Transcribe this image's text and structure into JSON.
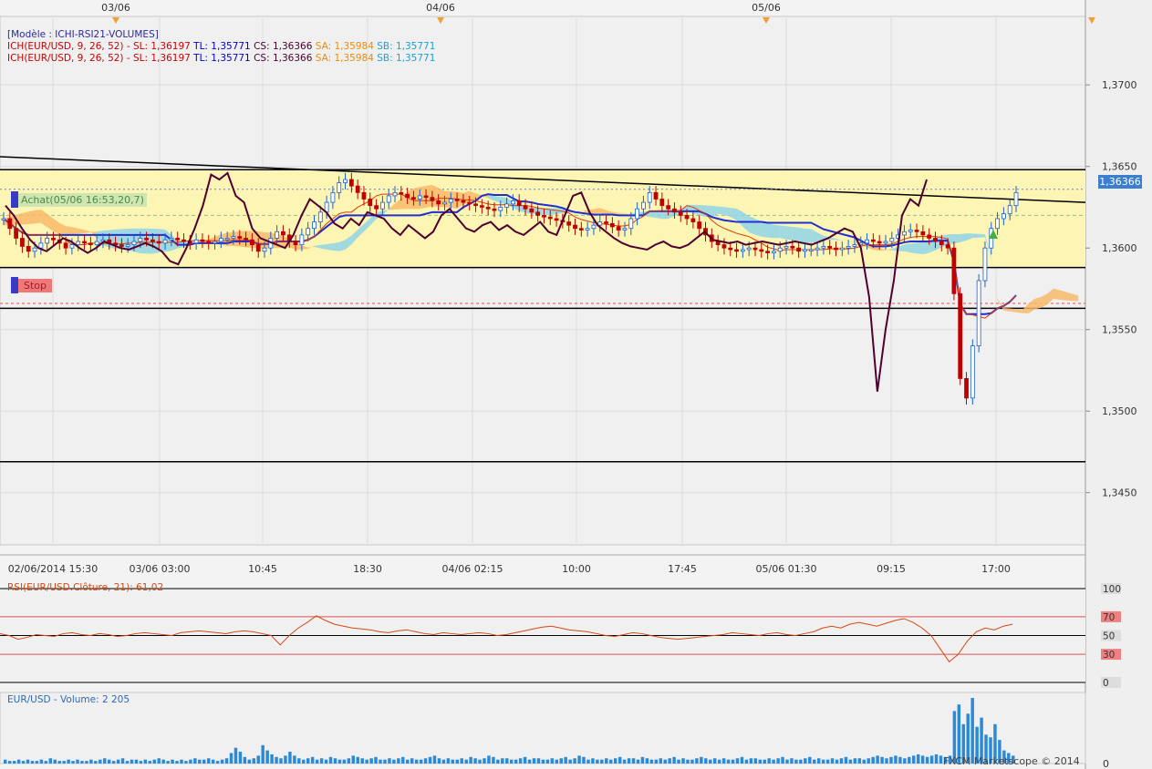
{
  "header": {
    "model": "[Modèle : ICHI-RSI21-VOLUMES]",
    "ich_lines": [
      {
        "prefix": "ICH(EUR/USD, 9, 26, 52) -",
        "sl": "SL: 1,36197",
        "tl": "TL: 1,35771",
        "cs": "CS: 1,36366",
        "sa": "SA: 1,35984",
        "sb": "SB: 1,35771"
      },
      {
        "prefix": "ICH(EUR/USD, 9, 26, 52) -",
        "sl": "SL: 1,36197",
        "tl": "TL: 1,35771",
        "cs": "CS: 1,36366",
        "sa": "SA: 1,35984",
        "sb": "SB: 1,35771"
      }
    ]
  },
  "colors": {
    "prefix": "#cc0000",
    "sl": "#cc0000",
    "tl": "#0000cc",
    "cs": "#4a0030",
    "sa": "#f08a00",
    "sb": "#1fa0d0",
    "price_up": "#1a5fd0",
    "price_down": "#c00000",
    "lagging": "#500030",
    "kijun": "#1f2fd0",
    "tenkan": "#e03a00",
    "cloud_bull": "#f8b86a",
    "cloud_bear": "#8fd4e8",
    "band": "#fcf5b4",
    "rsi": "#d24a14",
    "volume": "#2a8ad8"
  },
  "top_dates": [
    "03/06",
    "04/06",
    "05/06"
  ],
  "annotations": {
    "achat": "Achat(05/06 16:53,20,7)",
    "stop": "Stop",
    "current_price": "1,36366"
  },
  "chart_data": [
    {
      "type": "line",
      "title": "EUR/USD",
      "x_tick_labels": [
        "02/06/2014 15:30",
        "03/06 03:00",
        "10:45",
        "18:30",
        "04/06 02:15",
        "10:00",
        "17:45",
        "05/06 01:30",
        "09:15",
        "17:00"
      ],
      "y_tick_labels": [
        "1,3700",
        "1,3650",
        "1,3600",
        "1,3550",
        "1,3500",
        "1,3450"
      ],
      "ylim": [
        1.3418,
        1.3742
      ],
      "price_series": [
        1.3618,
        1.3612,
        1.3606,
        1.3601,
        1.3598,
        1.36,
        1.3603,
        1.3606,
        1.3605,
        1.3603,
        1.36,
        1.3602,
        1.3604,
        1.3603,
        1.3602,
        1.3604,
        1.3605,
        1.3603,
        1.3602,
        1.3601,
        1.3602,
        1.3604,
        1.3606,
        1.3605,
        1.3604,
        1.3603,
        1.3605,
        1.3606,
        1.3605,
        1.3604,
        1.3603,
        1.3605,
        1.3604,
        1.3603,
        1.3604,
        1.3606,
        1.3606,
        1.3607,
        1.3606,
        1.3605,
        1.3602,
        1.3598,
        1.36,
        1.3606,
        1.361,
        1.3608,
        1.3604,
        1.3602,
        1.3608,
        1.3612,
        1.3616,
        1.3622,
        1.3628,
        1.3634,
        1.364,
        1.3642,
        1.3638,
        1.3634,
        1.363,
        1.3626,
        1.3624,
        1.3628,
        1.3632,
        1.3634,
        1.3633,
        1.3631,
        1.363,
        1.3632,
        1.3631,
        1.3629,
        1.3627,
        1.3628,
        1.363,
        1.3629,
        1.3628,
        1.3627,
        1.3626,
        1.3625,
        1.3624,
        1.3623,
        1.3625,
        1.3627,
        1.3629,
        1.3626,
        1.3624,
        1.3622,
        1.362,
        1.3619,
        1.3618,
        1.3617,
        1.3616,
        1.3614,
        1.3612,
        1.3611,
        1.3612,
        1.3614,
        1.3616,
        1.3615,
        1.3613,
        1.3611,
        1.3612,
        1.3618,
        1.3624,
        1.3628,
        1.3634,
        1.363,
        1.3626,
        1.3624,
        1.3622,
        1.362,
        1.3618,
        1.3616,
        1.3612,
        1.3608,
        1.3604,
        1.3602,
        1.36,
        1.3599,
        1.3598,
        1.3599,
        1.36,
        1.3599,
        1.3598,
        1.3597,
        1.3598,
        1.36,
        1.3601,
        1.36,
        1.3598,
        1.3599,
        1.3599,
        1.36,
        1.3601,
        1.36,
        1.3599,
        1.36,
        1.3601,
        1.3602,
        1.3603,
        1.3605,
        1.3604,
        1.3603,
        1.3604,
        1.3606,
        1.3608,
        1.361,
        1.3611,
        1.361,
        1.3608,
        1.3606,
        1.3604,
        1.3602,
        1.36,
        1.3572,
        1.352,
        1.3508,
        1.354,
        1.358,
        1.36,
        1.3612,
        1.3618,
        1.3621,
        1.3626,
        1.3634
      ],
      "lagging_series": [
        1.3626,
        1.362,
        1.3612,
        1.3605,
        1.36,
        1.3598,
        1.3602,
        1.3606,
        1.3604,
        1.36,
        1.3597,
        1.36,
        1.3604,
        1.3602,
        1.36,
        1.3599,
        1.3601,
        1.3603,
        1.3601,
        1.3598,
        1.3592,
        1.359,
        1.36,
        1.3612,
        1.3626,
        1.3645,
        1.3642,
        1.3646,
        1.3632,
        1.3628,
        1.3612,
        1.3606,
        1.3604,
        1.3602,
        1.36,
        1.3608,
        1.362,
        1.363,
        1.3626,
        1.3622,
        1.3615,
        1.3612,
        1.3618,
        1.3614,
        1.3622,
        1.362,
        1.3618,
        1.3612,
        1.3608,
        1.3614,
        1.361,
        1.3606,
        1.361,
        1.362,
        1.3624,
        1.3618,
        1.3612,
        1.361,
        1.3614,
        1.3616,
        1.3611,
        1.3614,
        1.361,
        1.3608,
        1.3612,
        1.3616,
        1.361,
        1.3608,
        1.362,
        1.3632,
        1.3634,
        1.3622,
        1.3614,
        1.361,
        1.3606,
        1.3603,
        1.3601,
        1.36,
        1.3599,
        1.3602,
        1.3604,
        1.3601,
        1.36,
        1.3602,
        1.3606,
        1.361,
        1.3605,
        1.3604,
        1.3603,
        1.3604,
        1.3602,
        1.3603,
        1.3604,
        1.3603,
        1.3602,
        1.3603,
        1.3604,
        1.3603,
        1.3602,
        1.3604,
        1.3606,
        1.3609,
        1.3612,
        1.361,
        1.36,
        1.357,
        1.3512,
        1.355,
        1.358,
        1.362,
        1.363,
        1.3626,
        1.3642
      ],
      "rsi": {
        "label": "RSI(EUR/USD.Clôture, 21): 61,02",
        "y_tick_labels": [
          "100",
          "70",
          "50",
          "30",
          "0"
        ],
        "values": [
          52,
          50,
          46,
          48,
          51,
          50,
          49,
          52,
          53,
          51,
          50,
          52,
          51,
          49,
          50,
          52,
          53,
          52,
          51,
          50,
          53,
          54,
          55,
          54,
          53,
          52,
          54,
          55,
          54,
          52,
          50,
          40,
          50,
          58,
          64,
          71,
          66,
          62,
          60,
          58,
          57,
          56,
          54,
          53,
          55,
          56,
          54,
          52,
          51,
          53,
          52,
          51,
          52,
          53,
          52,
          50,
          51,
          53,
          55,
          57,
          59,
          60,
          58,
          56,
          55,
          54,
          52,
          50,
          49,
          51,
          53,
          52,
          50,
          48,
          47,
          46,
          47,
          48,
          49,
          50,
          51,
          53,
          52,
          51,
          50,
          52,
          53,
          51,
          50,
          52,
          54,
          58,
          60,
          58,
          62,
          64,
          62,
          60,
          63,
          66,
          68,
          64,
          58,
          50,
          36,
          22,
          30,
          44,
          54,
          58,
          56,
          60,
          62
        ]
      },
      "volume": {
        "label": "EUR/USD - Volume: 2 205",
        "y_tick_label": "0",
        "values": [
          3,
          2,
          2,
          3,
          2,
          3,
          2,
          2,
          3,
          2,
          4,
          3,
          2,
          2,
          3,
          2,
          3,
          2,
          2,
          3,
          2,
          3,
          4,
          3,
          2,
          3,
          4,
          2,
          3,
          3,
          2,
          3,
          2,
          3,
          4,
          3,
          2,
          3,
          2,
          3,
          2,
          3,
          4,
          3,
          3,
          4,
          3,
          2,
          3,
          4,
          8,
          12,
          9,
          5,
          3,
          4,
          6,
          14,
          10,
          7,
          5,
          4,
          6,
          9,
          6,
          4,
          3,
          4,
          5,
          3,
          4,
          3,
          5,
          4,
          3,
          3,
          4,
          6,
          5,
          4,
          3,
          4,
          5,
          3,
          3,
          4,
          3,
          4,
          5,
          3,
          4,
          3,
          3,
          4,
          5,
          6,
          4,
          3,
          4,
          3,
          3,
          4,
          3,
          5,
          4,
          3,
          4,
          6,
          5,
          3,
          4,
          4,
          3,
          3,
          4,
          5,
          3,
          4,
          4,
          3,
          3,
          4,
          3,
          4,
          5,
          3,
          4,
          6,
          5,
          3,
          4,
          3,
          3,
          4,
          3,
          4,
          5,
          3,
          4,
          4,
          3,
          5,
          4,
          3,
          3,
          4,
          3,
          4,
          5,
          3,
          4,
          3,
          3,
          4,
          5,
          4,
          3,
          4,
          3,
          4,
          3,
          3,
          4,
          5,
          3,
          4,
          4,
          3,
          3,
          4,
          3,
          4,
          5,
          3,
          4,
          3,
          3,
          4,
          5,
          3,
          4,
          3,
          3,
          4,
          3,
          4,
          5,
          3,
          4,
          4,
          3,
          4,
          5,
          6,
          5,
          4,
          5,
          6,
          5,
          4,
          5,
          6,
          7,
          6,
          5,
          6,
          7,
          6,
          5,
          6,
          40,
          45,
          30,
          38,
          50,
          28,
          35,
          22,
          20,
          30,
          18,
          10,
          8,
          6
        ]
      }
    }
  ],
  "footer": "FXCM Marketscope © 2014"
}
